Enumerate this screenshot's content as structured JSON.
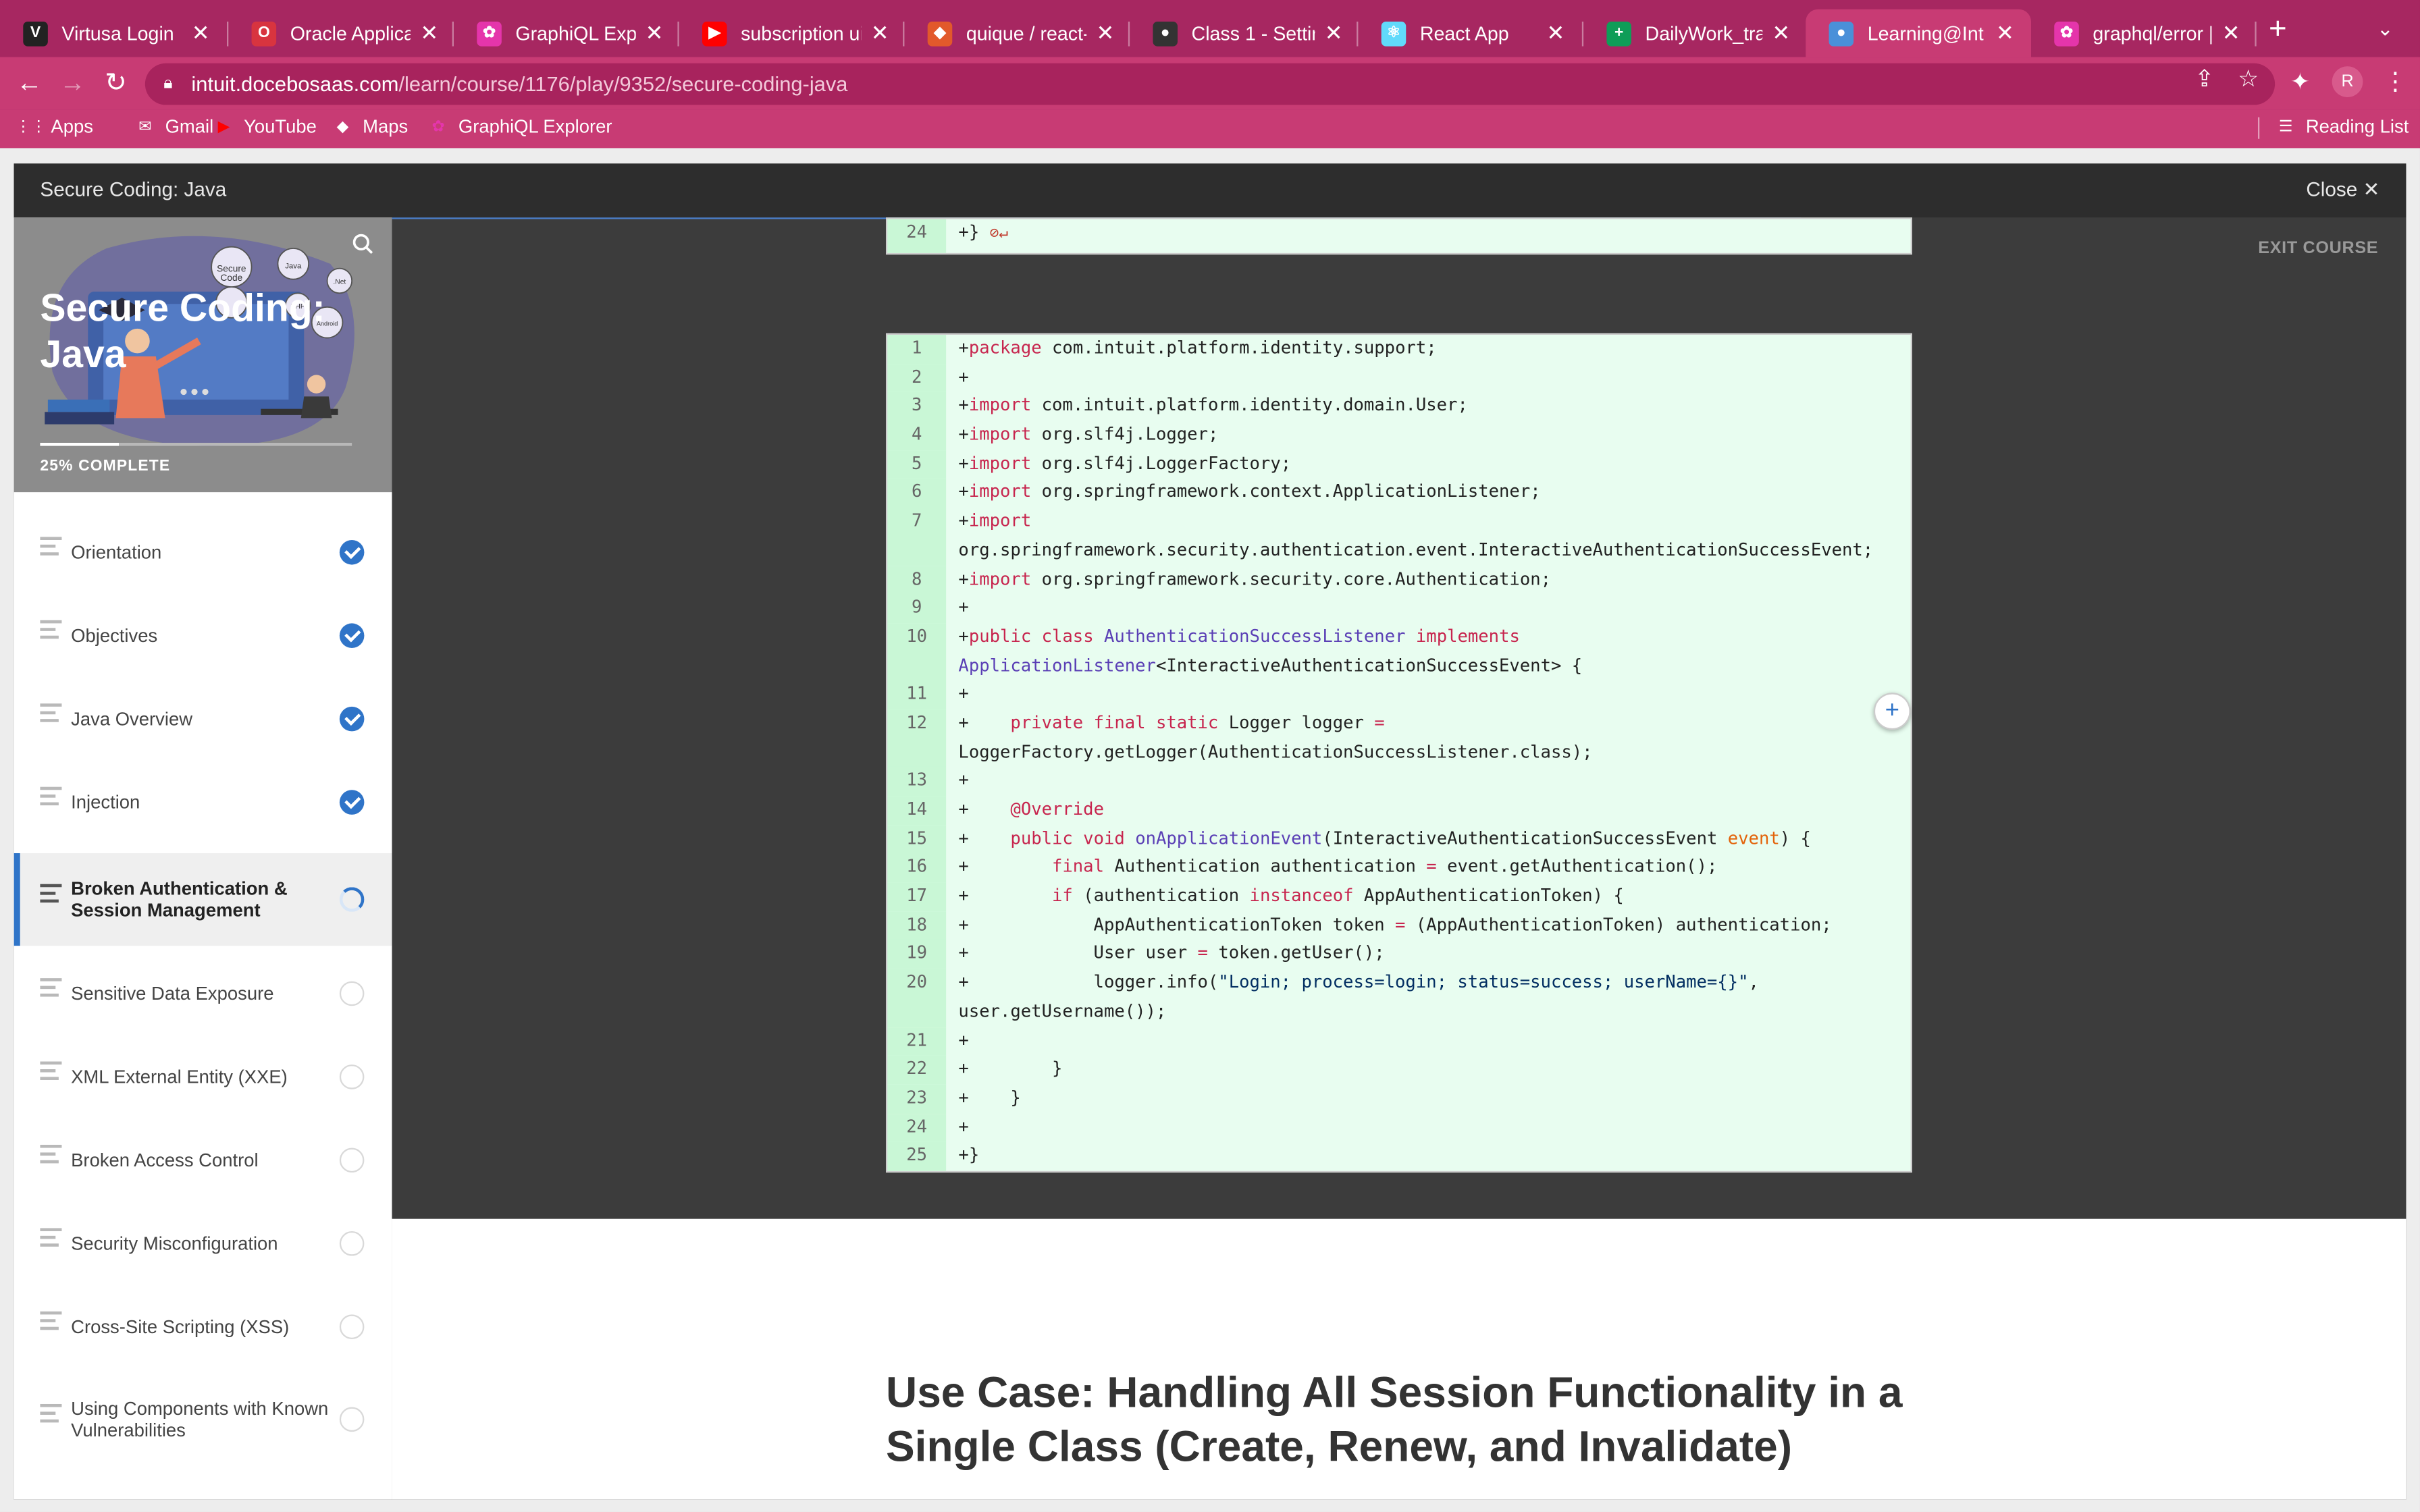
{
  "tabs": [
    {
      "title": "Virtusa Login",
      "favicon_color": "#222222",
      "favicon_glyph": "V"
    },
    {
      "title": "Oracle Applications",
      "favicon_color": "#d8343f",
      "favicon_glyph": "O"
    },
    {
      "title": "GraphiQL Explorer",
      "favicon_color": "#e535ab",
      "favicon_glyph": "✿"
    },
    {
      "title": "subscription ui react",
      "favicon_color": "#ff0000",
      "favicon_glyph": "▶"
    },
    {
      "title": "quique / react-graph",
      "favicon_color": "#e2592b",
      "favicon_glyph": "◆"
    },
    {
      "title": "Class 1 - Setting up",
      "favicon_color": "#333333",
      "favicon_glyph": "●"
    },
    {
      "title": "React App",
      "favicon_color": "#61dafb",
      "favicon_glyph": "⚛"
    },
    {
      "title": "DailyWork_tracker",
      "favicon_color": "#0f9d58",
      "favicon_glyph": "+"
    },
    {
      "title": "Learning@Intuit",
      "favicon_color": "#4a90d9",
      "favicon_glyph": "●"
    },
    {
      "title": "graphql/error | Gr",
      "favicon_color": "#e535ab",
      "favicon_glyph": "✿"
    }
  ],
  "active_tab_index": 8,
  "url": {
    "host": "intuit.docebosaas.com",
    "path": "/learn/course/1176/play/9352/secure-coding-java"
  },
  "profile_initial": "R",
  "bookmarks": [
    {
      "label": "Apps",
      "icon": "apps-grid-icon",
      "color": "#ffffff"
    },
    {
      "label": "Gmail",
      "icon": "gmail-icon",
      "color": "#ffffff"
    },
    {
      "label": "YouTube",
      "icon": "youtube-icon",
      "color": "#ff0000"
    },
    {
      "label": "Maps",
      "icon": "maps-icon",
      "color": "#ffffff"
    },
    {
      "label": "GraphiQL Explorer",
      "icon": "graphql-icon",
      "color": "#e535ab"
    }
  ],
  "reading_list_label": "Reading List",
  "course": {
    "header_title": "Secure Coding: Java",
    "close_label": "Close",
    "hero_title": "Secure Coding: Java",
    "progress_percent": 25,
    "progress_label": "25% COMPLETE",
    "exit_label": "EXIT COURSE",
    "hero_badges": [
      "Java",
      "Secure Code",
      "Net",
      "PHP",
      "Android"
    ]
  },
  "lessons": [
    {
      "label": "Orientation",
      "status": "done"
    },
    {
      "label": "Objectives",
      "status": "done"
    },
    {
      "label": "Java Overview",
      "status": "done"
    },
    {
      "label": "Injection",
      "status": "done"
    },
    {
      "label": "Broken Authentication & Session Management",
      "status": "in-progress"
    },
    {
      "label": "Sensitive Data Exposure",
      "status": "todo"
    },
    {
      "label": "XML External Entity (XXE)",
      "status": "todo"
    },
    {
      "label": "Broken Access Control",
      "status": "todo"
    },
    {
      "label": "Security Misconfiguration",
      "status": "todo"
    },
    {
      "label": "Cross-Site Scripting (XSS)",
      "status": "todo"
    },
    {
      "label": "Using Components with Known Vulnerabilities",
      "status": "todo"
    }
  ],
  "code_top": {
    "line_number": "24",
    "text": "+}",
    "markers": "⊘↵"
  },
  "code_main": [
    {
      "ln": "1",
      "html": "+<span class=\"kw\">package</span> com.intuit.platform.identity.support;"
    },
    {
      "ln": "2",
      "html": "+"
    },
    {
      "ln": "3",
      "html": "+<span class=\"kw\">import</span> com.intuit.platform.identity.domain.User;"
    },
    {
      "ln": "4",
      "html": "+<span class=\"kw\">import</span> org.slf4j.Logger;"
    },
    {
      "ln": "5",
      "html": "+<span class=\"kw\">import</span> org.slf4j.LoggerFactory;"
    },
    {
      "ln": "6",
      "html": "+<span class=\"kw\">import</span> org.springframework.context.ApplicationListener;"
    },
    {
      "ln": "7",
      "html": "+<span class=\"kw\">import</span>\norg.springframework.security.authentication.event.InteractiveAuthenticationSuccessEvent;"
    },
    {
      "ln": "8",
      "html": "+<span class=\"kw\">import</span> org.springframework.security.core.Authentication;"
    },
    {
      "ln": "9",
      "html": "+"
    },
    {
      "ln": "10",
      "html": "+<span class=\"kw\">public class</span> <span class=\"ty\">AuthenticationSuccessListener</span> <span class=\"kw\">implements</span>\n<span class=\"ty\">ApplicationListener</span>&lt;InteractiveAuthenticationSuccessEvent&gt; {"
    },
    {
      "ln": "11",
      "html": "+"
    },
    {
      "ln": "12",
      "html": "+    <span class=\"kw\">private final static</span> Logger logger <span class=\"kw\">=</span>\nLoggerFactory.getLogger(AuthenticationSuccessListener.class);"
    },
    {
      "ln": "13",
      "html": "+"
    },
    {
      "ln": "14",
      "html": "+    <span class=\"at\">@Override</span>"
    },
    {
      "ln": "15",
      "html": "+    <span class=\"kw\">public void</span> <span class=\"ty\">onApplicationEvent</span>(InteractiveAuthenticationSuccessEvent <span class=\"pa\">event</span>) {"
    },
    {
      "ln": "16",
      "html": "+        <span class=\"kw\">final</span> Authentication authentication <span class=\"kw\">=</span> event.getAuthentication();"
    },
    {
      "ln": "17",
      "html": "+        <span class=\"kw\">if</span> (authentication <span class=\"kw\">instanceof</span> AppAuthenticationToken) {"
    },
    {
      "ln": "18",
      "html": "+            AppAuthenticationToken token <span class=\"kw\">=</span> (AppAuthenticationToken) authentication;"
    },
    {
      "ln": "19",
      "html": "+            User user <span class=\"kw\">=</span> token.getUser();"
    },
    {
      "ln": "20",
      "html": "+            logger.info(<span class=\"st\">\"Login; process=login; status=success; userName={}\"</span>,\nuser.getUsername());"
    },
    {
      "ln": "21",
      "html": "+"
    },
    {
      "ln": "22",
      "html": "+        }"
    },
    {
      "ln": "23",
      "html": "+    }"
    },
    {
      "ln": "24",
      "html": "+"
    },
    {
      "ln": "25",
      "html": "+}"
    }
  ],
  "usecase_title": "Use Case: Handling All Session Functionality in a Single Class (Create, Renew, and Invalidate)"
}
